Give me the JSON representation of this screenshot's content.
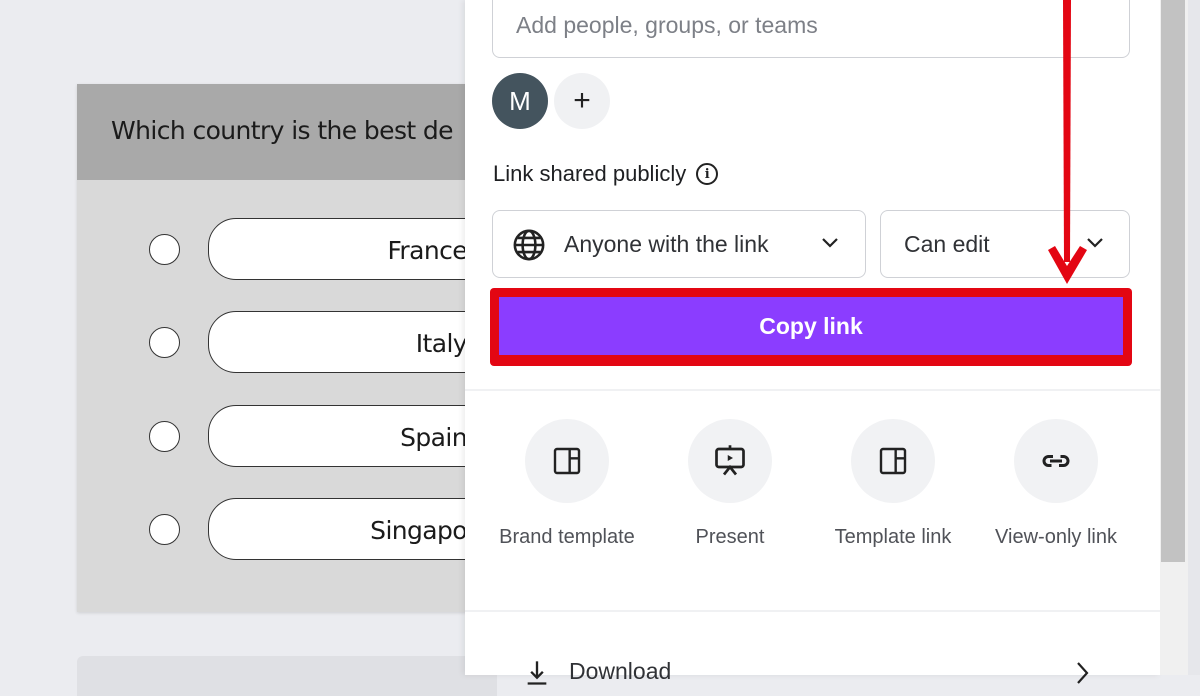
{
  "quiz": {
    "question": "Which country is the best de",
    "options": [
      {
        "label": "France"
      },
      {
        "label": "Italy"
      },
      {
        "label": "Spain"
      },
      {
        "label": "Singapo"
      }
    ]
  },
  "share_panel": {
    "people_input": {
      "placeholder": "Add people, groups, or teams",
      "value": ""
    },
    "avatar_initial": "M",
    "add_person_symbol": "+",
    "link_section_label": "Link shared publicly",
    "access_dropdown": {
      "selected": "Anyone with the link",
      "icon": "globe-icon"
    },
    "role_dropdown": {
      "selected": "Can edit"
    },
    "copy_button_label": "Copy link",
    "share_options": [
      {
        "label": "Brand template",
        "icon": "layout-template-icon"
      },
      {
        "label": "Present",
        "icon": "presentation-screen-icon"
      },
      {
        "label": "Template link",
        "icon": "layout-template-icon"
      },
      {
        "label": "View-only link",
        "icon": "link-icon"
      }
    ],
    "download_label": "Download"
  },
  "annotation": {
    "highlight_color": "#e30613",
    "target": "Copy link"
  },
  "colors": {
    "primary_button": "#8b3dff",
    "annotation_red": "#e30613",
    "avatar_bg": "#44545e"
  }
}
